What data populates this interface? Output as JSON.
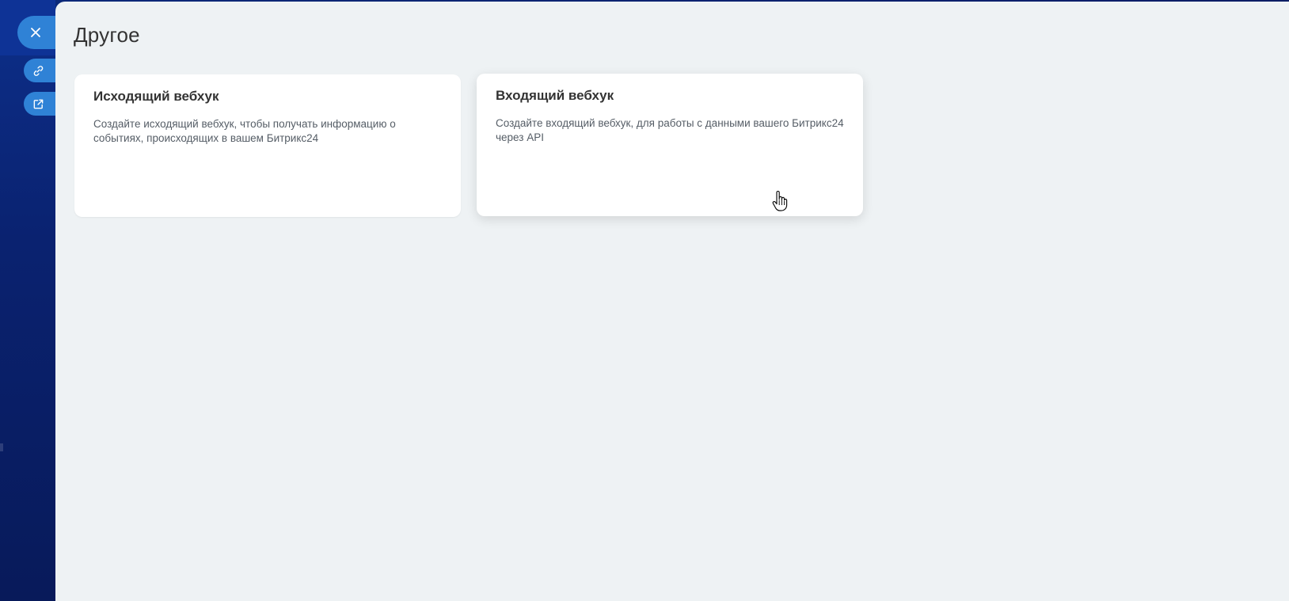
{
  "page": {
    "title": "Другое"
  },
  "side_buttons": {
    "close_icon": "close-icon",
    "link_icon": "link-icon",
    "external_icon": "external-link-icon"
  },
  "cards": [
    {
      "title": "Исходящий вебхук",
      "description": "Создайте исходящий вебхук, чтобы получать информацию о событиях, происходящих в вашем Битрикс24"
    },
    {
      "title": "Входящий вебхук",
      "description": "Создайте входящий вебхук, для работы с данными вашего Битрикс24 через API"
    }
  ],
  "colors": {
    "accent": "#2f82d6",
    "panel_bg": "#eef2f4",
    "background": "#0a1f6b"
  }
}
